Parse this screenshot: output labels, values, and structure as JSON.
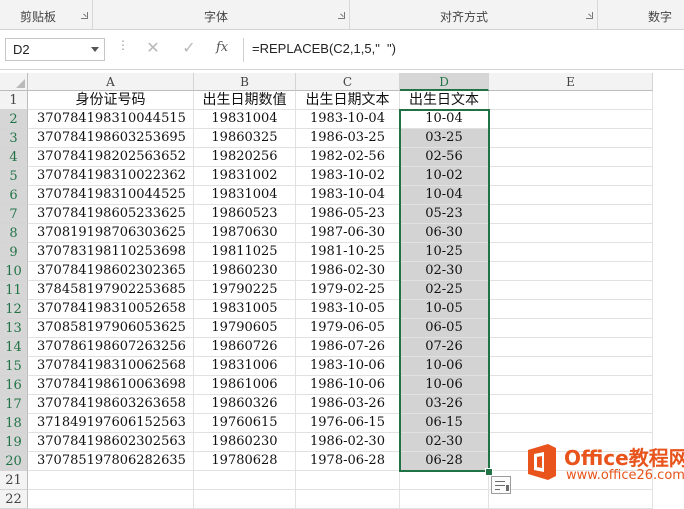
{
  "ribbon": {
    "groups": [
      "剪贴板",
      "字体",
      "对齐方式",
      "数字"
    ]
  },
  "formula_bar": {
    "name_box": "D2",
    "cancel_icon": "✕",
    "enter_icon": "✓",
    "fx_label": "fx",
    "formula": "=REPLACEB(C2,1,5,\"  \")"
  },
  "grid": {
    "columns": [
      "A",
      "B",
      "C",
      "D",
      "E"
    ],
    "selected_column": "D",
    "row_numbers": [
      "1",
      "2",
      "3",
      "4",
      "5",
      "6",
      "7",
      "8",
      "9",
      "10",
      "11",
      "12",
      "13",
      "14",
      "15",
      "16",
      "17",
      "18",
      "19",
      "20",
      "21",
      "22"
    ],
    "headers": [
      "身份证号码",
      "出生日期数值",
      "出生日期文本",
      "出生日文本"
    ],
    "rows": [
      [
        "370784198310044515",
        "19831004",
        "1983-10-04",
        "10-04"
      ],
      [
        "370784198603253695",
        "19860325",
        "1986-03-25",
        "03-25"
      ],
      [
        "370784198202563652",
        "19820256",
        "1982-02-56",
        "02-56"
      ],
      [
        "370784198310022362",
        "19831002",
        "1983-10-02",
        "10-02"
      ],
      [
        "370784198310044525",
        "19831004",
        "1983-10-04",
        "10-04"
      ],
      [
        "370784198605233625",
        "19860523",
        "1986-05-23",
        "05-23"
      ],
      [
        "370819198706303625",
        "19870630",
        "1987-06-30",
        "06-30"
      ],
      [
        "370783198110253698",
        "19811025",
        "1981-10-25",
        "10-25"
      ],
      [
        "370784198602302365",
        "19860230",
        "1986-02-30",
        "02-30"
      ],
      [
        "378458197902253685",
        "19790225",
        "1979-02-25",
        "02-25"
      ],
      [
        "370784198310052658",
        "19831005",
        "1983-10-05",
        "10-05"
      ],
      [
        "370858197906053625",
        "19790605",
        "1979-06-05",
        "06-05"
      ],
      [
        "370786198607263256",
        "19860726",
        "1986-07-26",
        "07-26"
      ],
      [
        "370784198310062568",
        "19831006",
        "1983-10-06",
        "10-06"
      ],
      [
        "370784198610063698",
        "19861006",
        "1986-10-06",
        "10-06"
      ],
      [
        "370784198603263658",
        "19860326",
        "1986-03-26",
        "03-26"
      ],
      [
        "371849197606152563",
        "19760615",
        "1976-06-15",
        "06-15"
      ],
      [
        "370784198602302563",
        "19860230",
        "1986-02-30",
        "02-30"
      ],
      [
        "370785197806282635",
        "19780628",
        "1978-06-28",
        "06-28"
      ]
    ]
  },
  "watermark": {
    "line1": "Office教程网",
    "line2": "www.office26.com"
  },
  "colors": {
    "excel_green": "#217346",
    "selection_fill": "#d3d3d3",
    "watermark_orange": "#e8541b"
  }
}
